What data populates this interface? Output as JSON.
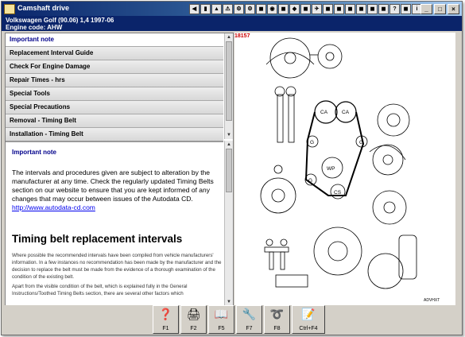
{
  "window": {
    "title": "Camshaft drive",
    "vehicle": "Volkswagen   Golf (90.06) 1,4   1997-06",
    "engine": "Engine code: AHW"
  },
  "menu": [
    {
      "label": "Important note"
    },
    {
      "label": "Replacement Interval Guide"
    },
    {
      "label": "Check For Engine Damage"
    },
    {
      "label": "Repair Times - hrs"
    },
    {
      "label": "Special Tools"
    },
    {
      "label": "Special Precautions"
    },
    {
      "label": "Removal - Timing Belt"
    },
    {
      "label": "Installation - Timing Belt"
    }
  ],
  "content": {
    "heading": "Important note",
    "body": "The intervals and procedures given are subject to alteration by the manufacturer at any time. Check the regularly updated Timing Belts section on our website to ensure that you are kept informed of any changes that may occur between issues of the Autodata CD.",
    "link": "http://www.autodata-cd.com",
    "section_title": "Timing belt replacement intervals",
    "para1": "Where possible the recommended intervals have been compiled from vehicle manufacturers' information. In a few instances no recommendation has been made by the manufacturer and the decision to replace the belt must be made from the evidence of a thorough examination of the condition of the existing belt.",
    "para2": "Apart from the visible condition of the belt, which is explained fully in the General Instructions/Toothed Timing Belts section, there are several other factors which"
  },
  "diagram": {
    "number": "18157",
    "labels": [
      "CA",
      "CA",
      "WP",
      "CS",
      "G",
      "G",
      "G",
      "ADVHXT"
    ]
  },
  "fkeys": [
    {
      "label": "F1",
      "icon": "help-icon",
      "glyph": "❓"
    },
    {
      "label": "F2",
      "icon": "print-icon",
      "glyph": "🖨"
    },
    {
      "label": "F5",
      "icon": "book-icon",
      "glyph": "📖"
    },
    {
      "label": "F7",
      "icon": "tools-icon",
      "glyph": "🔧"
    },
    {
      "label": "F8",
      "icon": "belt-icon",
      "glyph": "➰"
    },
    {
      "label": "Ctrl+F4",
      "icon": "notes-icon",
      "glyph": "📝"
    }
  ],
  "toolbar_icons": [
    "◀",
    "▮",
    "▲",
    "⚠",
    "⚙",
    "⚙",
    "◼",
    "◉",
    "◼",
    "◆",
    "◼",
    "✈",
    "◼",
    "◼",
    "◼",
    "◼",
    "◼",
    "◼",
    "?",
    "◼",
    "i"
  ],
  "window_buttons": [
    "_",
    "□",
    "×"
  ],
  "colors": {
    "title_bar": "#0a246a",
    "accent_red": "#cc0000",
    "link": "#0000ee"
  }
}
